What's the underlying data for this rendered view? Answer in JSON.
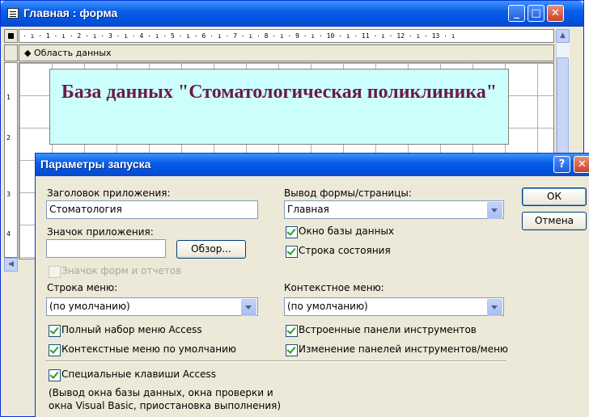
{
  "form_window": {
    "title": "Главная : форма",
    "minimize_glyph": "_",
    "maximize_glyph": "□",
    "close_glyph": "✕",
    "h_ruler": "· ı · 1 · ı · 2 · ı · 3 · ı · 4 · ı · 5 · ı · 6 · ı · 7 · ı · 8 · ı · 9 · ı · 10 · ı · 11 · ı · 12 · ı · 13 · ı",
    "section_label": "◆ Область данных",
    "title_label": "База данных \"Стоматологическая поликлиника\"",
    "v_ruler_marks": [
      "1",
      "2",
      "3",
      "4"
    ]
  },
  "dialog": {
    "title": "Параметры запуска",
    "help_glyph": "?",
    "close_glyph": "✕",
    "app_title_label": "Заголовок приложения:",
    "app_title_value": "Стоматология",
    "app_icon_label": "Значок приложения:",
    "app_icon_value": "",
    "browse_button": "Обзор...",
    "icon_forms_reports_label": "Значок форм и отчетов",
    "display_form_label": "Вывод формы/страницы:",
    "display_form_value": "Главная",
    "db_window_label": "Окно базы данных",
    "status_bar_label": "Строка состояния",
    "ok_button": "ОК",
    "cancel_button": "Отмена",
    "menu_bar_label": "Строка меню:",
    "menu_bar_value": "(по умолчанию)",
    "shortcut_menu_label": "Контекстное меню:",
    "shortcut_menu_value": "(по умолчанию)",
    "full_menus_label": "Полный набор меню Access",
    "default_shortcut_menus_label": "Контекстные меню по умолчанию",
    "builtin_toolbars_label": "Встроенные панели инструментов",
    "toolbar_changes_label": "Изменение панелей инструментов/меню",
    "special_keys_label": "Специальные клавиши Access",
    "special_keys_note_1": "(Вывод окна базы данных, окна проверки и",
    "special_keys_note_2": "окна Visual Basic, приостановка выполнения)"
  }
}
